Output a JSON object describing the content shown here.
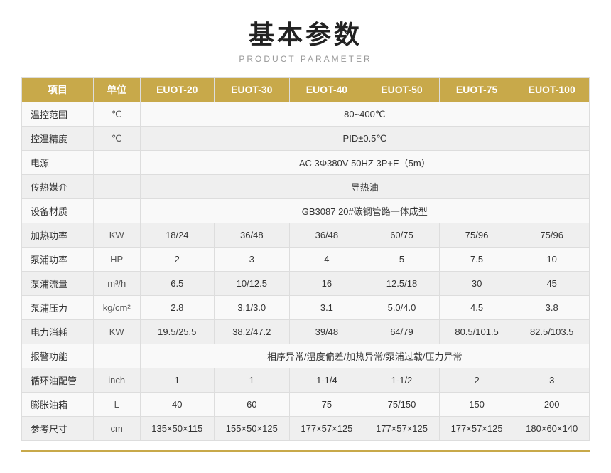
{
  "header": {
    "title": "基本参数",
    "subtitle": "PRODUCT PARAMETER"
  },
  "table": {
    "columns": [
      "项目",
      "单位",
      "EUOT-20",
      "EUOT-30",
      "EUOT-40",
      "EUOT-50",
      "EUOT-75",
      "EUOT-100"
    ],
    "rows": [
      {
        "label": "温控范围",
        "unit": "℃",
        "span": true,
        "spanValue": "80~400℃"
      },
      {
        "label": "控温精度",
        "unit": "℃",
        "span": true,
        "spanValue": "PID±0.5℃"
      },
      {
        "label": "电源",
        "unit": "",
        "span": true,
        "spanValue": "AC 3Φ380V 50HZ 3P+E（5m）"
      },
      {
        "label": "传热媒介",
        "unit": "",
        "span": true,
        "spanValue": "导热油"
      },
      {
        "label": "设备材质",
        "unit": "",
        "span": true,
        "spanValue": "GB3087   20#碳钢管路一体成型"
      },
      {
        "label": "加热功率",
        "unit": "KW",
        "span": false,
        "values": [
          "18/24",
          "36/48",
          "36/48",
          "60/75",
          "75/96",
          "75/96"
        ]
      },
      {
        "label": "泵浦功率",
        "unit": "HP",
        "span": false,
        "values": [
          "2",
          "3",
          "4",
          "5",
          "7.5",
          "10"
        ]
      },
      {
        "label": "泵浦流量",
        "unit": "m³/h",
        "span": false,
        "values": [
          "6.5",
          "10/12.5",
          "16",
          "12.5/18",
          "30",
          "45"
        ]
      },
      {
        "label": "泵浦压力",
        "unit": "kg/cm²",
        "span": false,
        "values": [
          "2.8",
          "3.1/3.0",
          "3.1",
          "5.0/4.0",
          "4.5",
          "3.8"
        ]
      },
      {
        "label": "电力消耗",
        "unit": "KW",
        "span": false,
        "values": [
          "19.5/25.5",
          "38.2/47.2",
          "39/48",
          "64/79",
          "80.5/101.5",
          "82.5/103.5"
        ]
      },
      {
        "label": "报警功能",
        "unit": "",
        "span": true,
        "spanValue": "相序异常/温度偏差/加热异常/泵浦过载/压力异常"
      },
      {
        "label": "循环油配管",
        "unit": "inch",
        "span": false,
        "values": [
          "1",
          "1",
          "1-1/4",
          "1-1/2",
          "2",
          "3"
        ]
      },
      {
        "label": "膨胀油箱",
        "unit": "L",
        "span": false,
        "values": [
          "40",
          "60",
          "75",
          "75/150",
          "150",
          "200"
        ]
      },
      {
        "label": "参考尺寸",
        "unit": "cm",
        "span": false,
        "values": [
          "135×50×115",
          "155×50×125",
          "177×57×125",
          "177×57×125",
          "177×57×125",
          "180×60×140"
        ]
      }
    ]
  }
}
